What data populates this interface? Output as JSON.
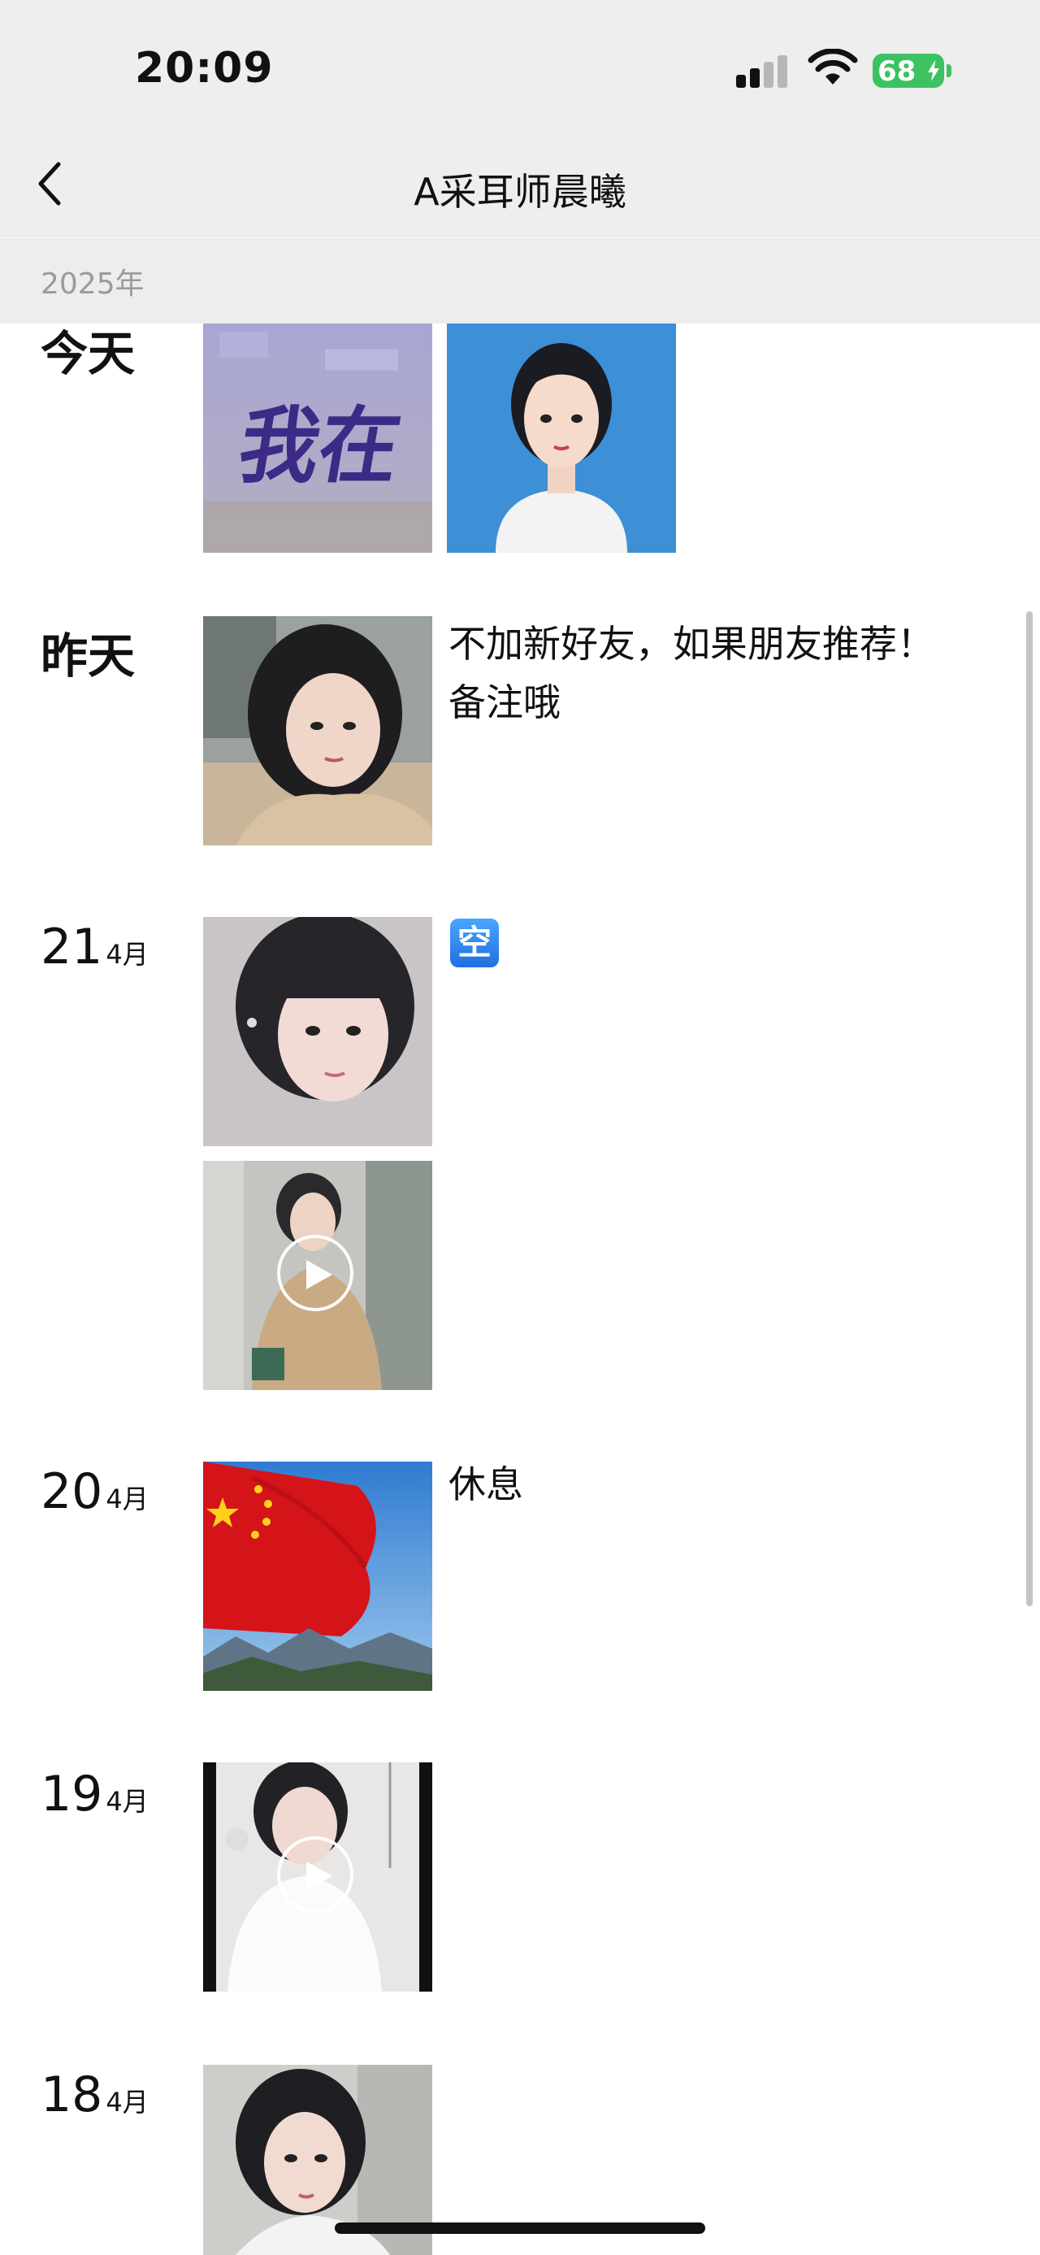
{
  "status_bar": {
    "time": "20:09",
    "battery_percent": "68",
    "battery_color": "#3cc261",
    "signal_bars_active": 2,
    "signal_bars_total": 4
  },
  "nav": {
    "title": "A采耳师晨曦",
    "back_icon": "chevron-left-icon"
  },
  "year_header": "2025年",
  "posts": [
    {
      "day": "今天",
      "text": "",
      "media": [
        "image",
        "image"
      ]
    },
    {
      "day": "昨天",
      "text_lines": [
        "不加新好友，如果朋友推荐！",
        "备注哦"
      ],
      "media": [
        "image"
      ]
    },
    {
      "date": "21",
      "month": "4月",
      "badge": "空",
      "media": [
        "image",
        "video"
      ]
    },
    {
      "date": "20",
      "month": "4月",
      "text_lines": [
        "休息"
      ],
      "media": [
        "image"
      ]
    },
    {
      "date": "19",
      "month": "4月",
      "media": [
        "video"
      ]
    },
    {
      "date": "18",
      "month": "4月",
      "media": [
        "image"
      ]
    }
  ],
  "thumbnail_captions": {
    "calligraphy": "我在"
  },
  "colors": {
    "header_bg": "#eeeeee",
    "year_text": "#9b9b9b",
    "text": "#111111"
  }
}
